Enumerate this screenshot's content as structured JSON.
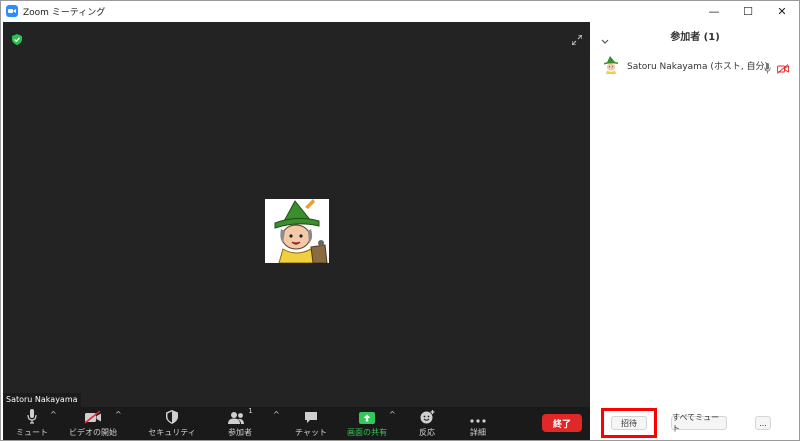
{
  "window": {
    "title": "Zoom ミーティング",
    "controls": [
      "—",
      "☐",
      "✕"
    ]
  },
  "video": {
    "participant_name": "Satoru Nakayama"
  },
  "toolbar": {
    "mute": "ミュート",
    "video": "ビデオの開始",
    "security": "セキュリティ",
    "participants": "参加者",
    "participants_count": "1",
    "chat": "チャット",
    "share": "画面の共有",
    "reactions": "反応",
    "more": "詳細",
    "end": "終了",
    "caret": "^"
  },
  "panel": {
    "title": "参加者 (1)",
    "participant": {
      "name": "Satoru Nakayama (ホスト, 自分)"
    },
    "invite": "招待",
    "mute_all": "すべてミュート",
    "more": "..."
  },
  "colors": {
    "accent": "#2d8cff",
    "end_red": "#e02828",
    "share_green": "#34c759",
    "highlight_red": "#ff0000"
  }
}
